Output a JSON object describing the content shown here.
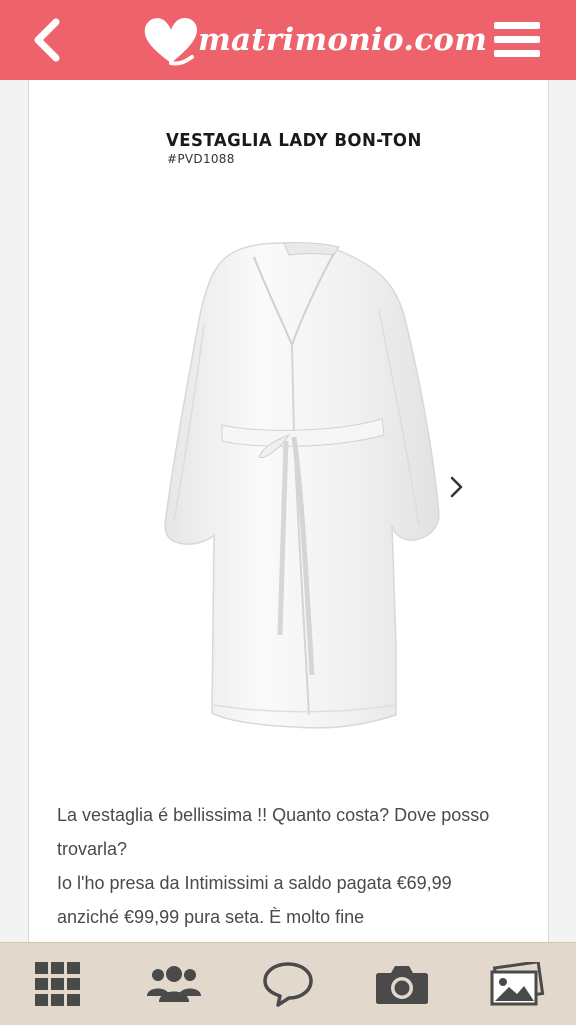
{
  "header": {
    "logo_text": "matrimonio.com",
    "colors": {
      "brand": "#ee636b",
      "icon": "#ffffff"
    },
    "icons": [
      "back-arrow-icon",
      "heart-icon",
      "hamburger-menu-icon"
    ]
  },
  "product": {
    "title": "VESTAGLIA LADY BON-TON",
    "code": "#PVD1088",
    "image_description_icon": "robe-image",
    "next_icon": "chevron-right-icon"
  },
  "post": {
    "lines": [
      "La vestaglia é bellissima !! Quanto costa? Dove posso trovarla?",
      "Io l'ho presa da Intimissimi a saldo pagata €69,99 anziché €99,99 pura seta. È molto fine"
    ]
  },
  "tabbar": {
    "background": "#e3d8cc",
    "icon_color": "#4a4a4a",
    "tabs": [
      {
        "icon": "grid-icon"
      },
      {
        "icon": "community-icon"
      },
      {
        "icon": "speech-bubble-icon"
      },
      {
        "icon": "camera-icon"
      },
      {
        "icon": "photos-icon"
      }
    ]
  }
}
